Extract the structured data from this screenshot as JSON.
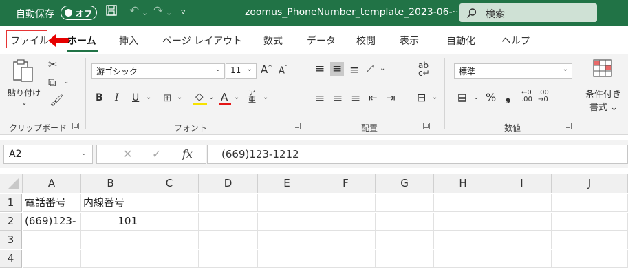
{
  "titlebar": {
    "autosave_label": "自動保存",
    "autosave_state": "オフ",
    "filename": "zoomus_PhoneNumber_template_2023-06-··· ⌄",
    "search_placeholder": "検索"
  },
  "tabs": [
    "ファイル",
    "ホーム",
    "挿入",
    "ページ レイアウト",
    "数式",
    "データ",
    "校閲",
    "表示",
    "自動化",
    "ヘルプ"
  ],
  "active_tab": "ホーム",
  "ribbon": {
    "clipboard": {
      "paste_label": "貼り付け",
      "group_label": "クリップボード"
    },
    "font": {
      "name": "游ゴシック",
      "size": "11",
      "bold": "B",
      "italic": "I",
      "underline": "U",
      "group_label": "フォント"
    },
    "alignment": {
      "group_label": "配置"
    },
    "number": {
      "format": "標準",
      "percent": "%",
      "comma": "❟",
      "group_label": "数値"
    },
    "styles": {
      "conditional_label_1": "条件付き",
      "conditional_label_2": "書式 ⌄"
    }
  },
  "formula_bar": {
    "name_box": "A2",
    "fx": "fx",
    "formula": "(669)123-1212"
  },
  "grid": {
    "columns": [
      "A",
      "B",
      "C",
      "D",
      "E",
      "F",
      "G",
      "H",
      "I",
      "J"
    ],
    "rows": [
      "1",
      "2",
      "3",
      "4"
    ],
    "cells": [
      [
        "電話番号",
        "内線番号",
        "",
        "",
        "",
        "",
        "",
        "",
        "",
        ""
      ],
      [
        "(669)123-",
        "101",
        "",
        "",
        "",
        "",
        "",
        "",
        "",
        ""
      ],
      [
        "",
        "",
        "",
        "",
        "",
        "",
        "",
        "",
        "",
        ""
      ],
      [
        "",
        "",
        "",
        "",
        "",
        "",
        "",
        "",
        "",
        ""
      ]
    ]
  },
  "colors": {
    "excel_green": "#217346",
    "highlight_red": "#e63434"
  }
}
